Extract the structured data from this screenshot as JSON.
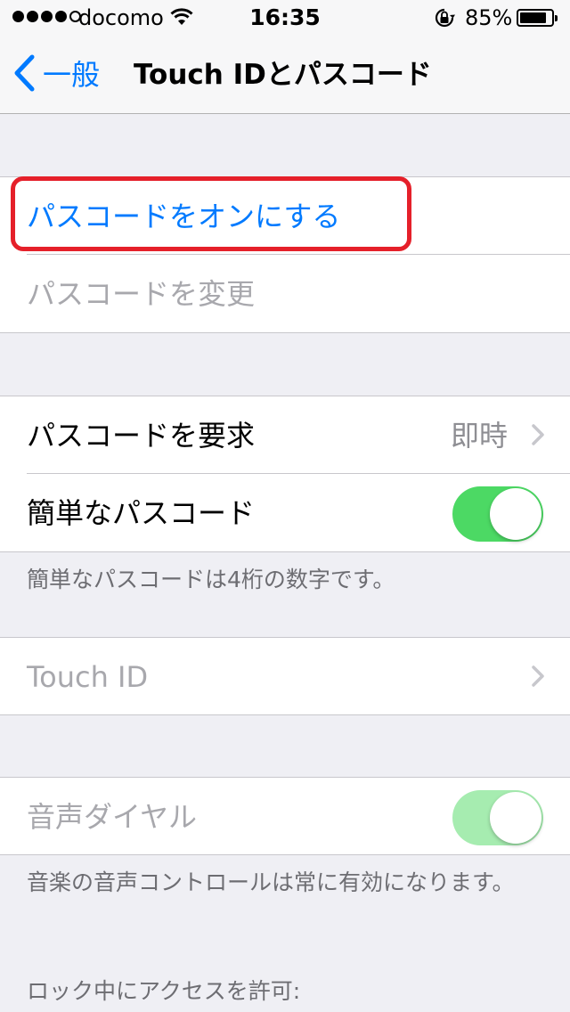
{
  "status_bar": {
    "carrier": "docomo",
    "time": "16:35",
    "battery_percent": "85%",
    "battery_level": 0.85,
    "signal_bars_filled": 4,
    "signal_bars_total": 5
  },
  "nav": {
    "back_label": "一般",
    "title": "Touch IDとパスコード"
  },
  "passcode_group": {
    "turn_on_label": "パスコードをオンにする",
    "change_label": "パスコードを変更"
  },
  "require_group": {
    "require_label": "パスコードを要求",
    "require_value": "即時",
    "simple_label": "簡単なパスコード",
    "simple_on": true,
    "footer": "簡単なパスコードは4桁の数字です。"
  },
  "touchid_group": {
    "label": "Touch ID"
  },
  "voice_group": {
    "voice_dial_label": "音声ダイヤル",
    "voice_dial_on": true,
    "footer": "音楽の音声コントロールは常に有効になります。"
  },
  "lock_section": {
    "header": "ロック中にアクセスを許可:"
  },
  "colors": {
    "accent": "#007aff",
    "toggle_on": "#4cd964",
    "highlight": "#e5202a"
  }
}
